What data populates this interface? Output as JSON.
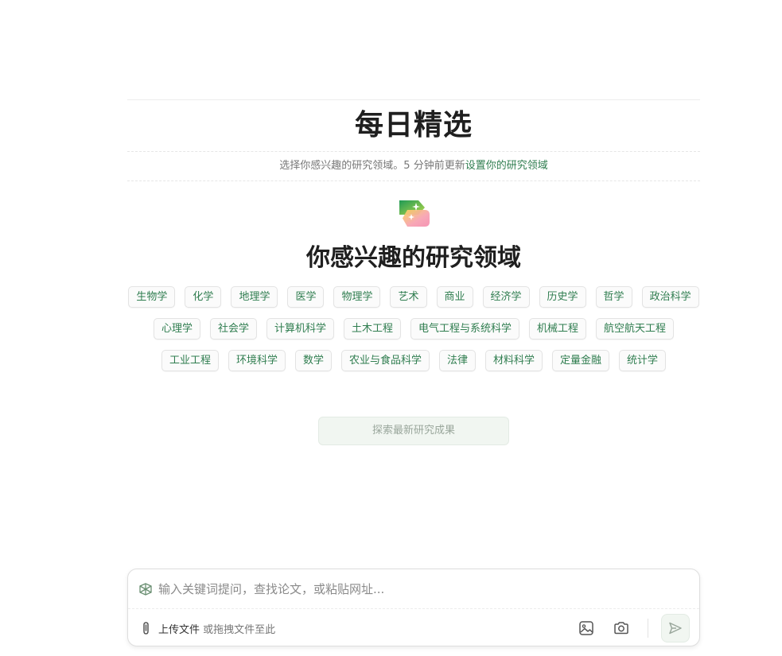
{
  "header": {
    "title": "每日精选",
    "subtitle_prefix": "选择你感兴趣的研究领域。",
    "subtitle_updated": "5 分钟前更新",
    "subtitle_link": "设置你的研究领域"
  },
  "section": {
    "title": "你感兴趣的研究领域",
    "icon": "sparkle-tags-icon"
  },
  "tags": [
    "生物学",
    "化学",
    "地理学",
    "医学",
    "物理学",
    "艺术",
    "商业",
    "经济学",
    "历史学",
    "哲学",
    "政治科学",
    "心理学",
    "社会学",
    "计算机科学",
    "土木工程",
    "电气工程与系统科学",
    "机械工程",
    "航空航天工程",
    "工业工程",
    "环境科学",
    "数学",
    "农业与食品科学",
    "法律",
    "材料科学",
    "定量金融",
    "统计学"
  ],
  "explore_button": "探索最新研究成果",
  "composer": {
    "placeholder": "输入关键词提问，查找论文，或粘贴网址...",
    "upload_link": "上传文件",
    "upload_hint": " 或拖拽文件至此",
    "icons": [
      "logo-icon",
      "paperclip-icon",
      "image-icon",
      "camera-icon",
      "send-icon"
    ]
  },
  "colors": {
    "accent_green": "#2f7d4f",
    "button_bg": "#f1f6f1",
    "button_text": "#9aa79c"
  }
}
